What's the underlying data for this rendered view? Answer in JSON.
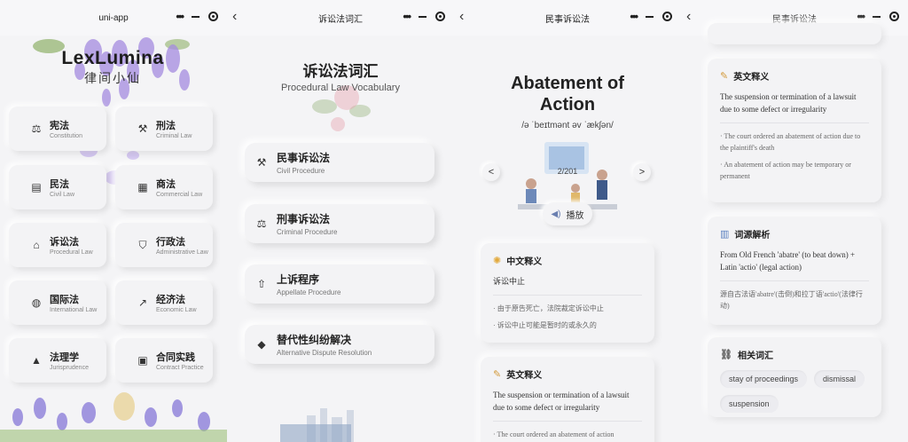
{
  "panel1": {
    "nav_title": "uni-app",
    "app_name": "LexLumina",
    "app_subtitle": "律间小仙",
    "categories": [
      {
        "zh": "宪法",
        "en": "Constitution"
      },
      {
        "zh": "刑法",
        "en": "Criminal Law"
      },
      {
        "zh": "民法",
        "en": "Civil Law"
      },
      {
        "zh": "商法",
        "en": "Commercial Law"
      },
      {
        "zh": "诉讼法",
        "en": "Procedural Law"
      },
      {
        "zh": "行政法",
        "en": "Administrative Law"
      },
      {
        "zh": "国际法",
        "en": "International Law"
      },
      {
        "zh": "经济法",
        "en": "Economic Law"
      },
      {
        "zh": "法理学",
        "en": "Jurisprudence"
      },
      {
        "zh": "合同实践",
        "en": "Contract Practice"
      }
    ]
  },
  "panel2": {
    "nav_title": "诉讼法词汇",
    "title": "诉讼法词汇",
    "subtitle": "Procedural Law Vocabulary",
    "items": [
      {
        "zh": "民事诉讼法",
        "en": "Civil Procedure"
      },
      {
        "zh": "刑事诉讼法",
        "en": "Criminal Procedure"
      },
      {
        "zh": "上诉程序",
        "en": "Appellate Procedure"
      },
      {
        "zh": "替代性纠纷解决",
        "en": "Alternative Dispute Resolution"
      }
    ]
  },
  "panel3": {
    "nav_title": "民事诉讼法",
    "term_line1": "Abatement of",
    "term_line2": "Action",
    "phonetic": "/ə ˈbeɪtmənt əv ˈækʃən/",
    "counter": "2/201",
    "prev_glyph": "<",
    "next_glyph": ">",
    "play_label": "播放",
    "cn_def": {
      "heading": "中文释义",
      "main": "诉讼中止",
      "examples": [
        "· 由于原告死亡，法院裁定诉讼中止",
        "· 诉讼中止可能是暂时的或永久的"
      ]
    },
    "en_def": {
      "heading": "英文释义",
      "main": "The suspension or termination of a lawsuit due to some defect or irregularity",
      "examples": [
        "· The court ordered an abatement of action"
      ]
    }
  },
  "panel4": {
    "nav_title": "民事诉讼法",
    "en_def": {
      "heading": "英文释义",
      "main": "The suspension or termination of a lawsuit due to some defect or irregularity",
      "examples": [
        "· The court ordered an abatement of action due to the plaintiff's death",
        "· An abatement of action may be temporary or permanent"
      ]
    },
    "etym": {
      "heading": "词源解析",
      "main": "From Old French 'abatre' (to beat down) + Latin 'actio' (legal action)",
      "note": "源自古法语'abatre'(击倒)和拉丁语'actio'(法律行动)"
    },
    "related": {
      "heading": "相关词汇",
      "tags": [
        "stay of proceedings",
        "dismissal",
        "suspension"
      ]
    }
  },
  "capsule": {
    "dots": "•••"
  },
  "colors": {
    "background": "#f4f4f6",
    "card": "#f3f3f5",
    "accent_purple": "#9b7fd0",
    "text": "#222222"
  }
}
